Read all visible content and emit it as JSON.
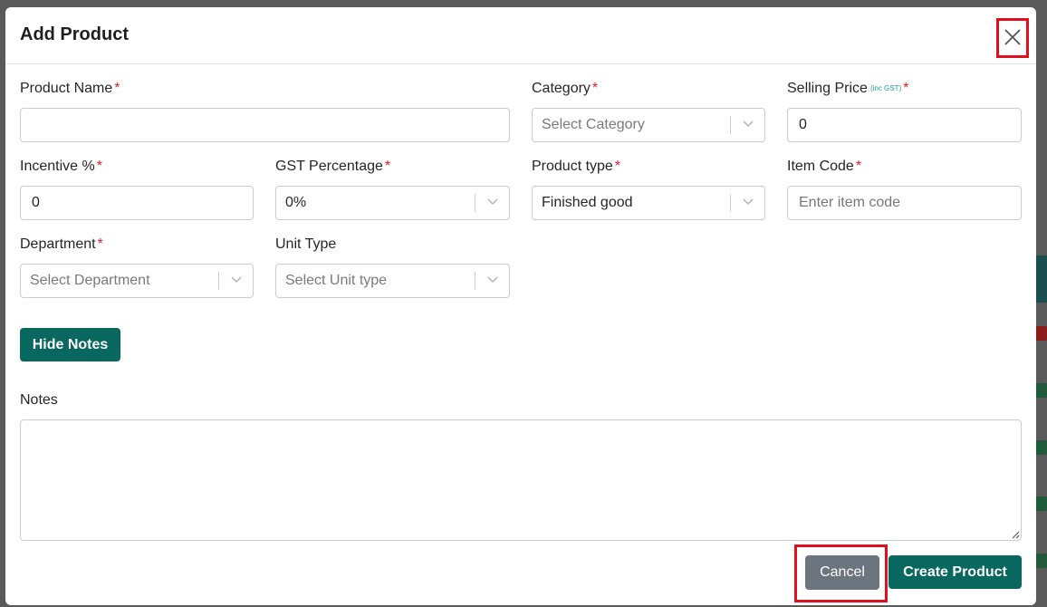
{
  "modal": {
    "title": "Add Product"
  },
  "fields": {
    "product_name": {
      "label": "Product Name",
      "required": "*",
      "value": "",
      "placeholder": ""
    },
    "category": {
      "label": "Category",
      "required": "*",
      "placeholder": "Select Category"
    },
    "selling_price": {
      "label": "Selling Price",
      "sublabel": "(inc GST)",
      "required": "*",
      "value": "0"
    },
    "incentive": {
      "label": "Incentive %",
      "required": "*",
      "value": "0"
    },
    "gst_percentage": {
      "label": "GST Percentage",
      "required": "*",
      "value": "0%"
    },
    "product_type": {
      "label": "Product type",
      "required": "*",
      "value": "Finished good"
    },
    "item_code": {
      "label": "Item Code",
      "required": "*",
      "value": "",
      "placeholder": "Enter item code"
    },
    "department": {
      "label": "Department",
      "required": "*",
      "placeholder": "Select Department"
    },
    "unit_type": {
      "label": "Unit Type",
      "placeholder": "Select Unit type"
    },
    "notes": {
      "label": "Notes",
      "value": ""
    }
  },
  "buttons": {
    "hide_notes": "Hide Notes",
    "cancel": "Cancel",
    "create": "Create Product"
  },
  "colors": {
    "primary": "#08675f",
    "secondary": "#6c757d",
    "required": "#d91f2a",
    "highlight": "#e0101e"
  }
}
